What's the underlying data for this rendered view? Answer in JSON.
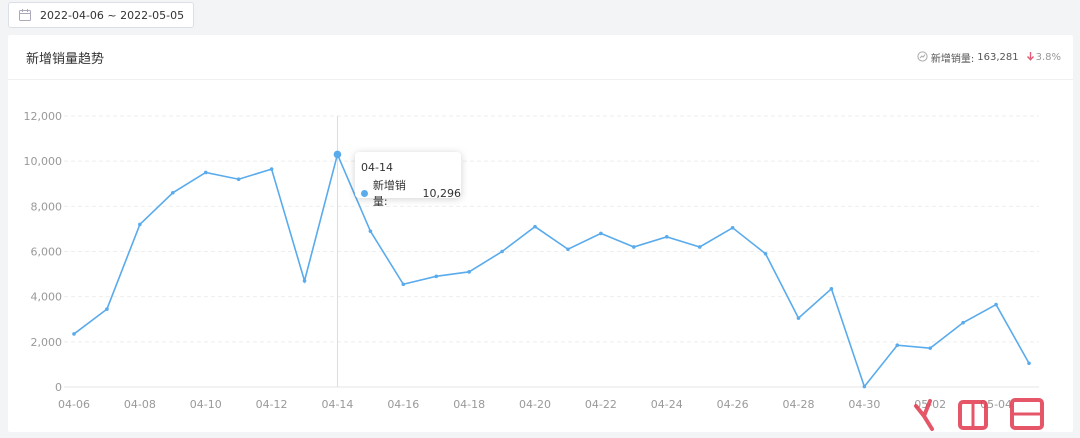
{
  "date_range": {
    "value": "2022-04-06 ~ 2022-05-05"
  },
  "card": {
    "title": "新增销量趋势",
    "summary_label": "新增销量:",
    "summary_value": "163,281",
    "delta_value": "3.8%"
  },
  "tooltip": {
    "date": "04-14",
    "series_label": "新增销量:",
    "value": "10,296"
  },
  "colors": {
    "line": "#5aabec",
    "delta_down": "#e55a75"
  },
  "icons": {
    "date_range": "calendar-icon",
    "summary": "trend-icon",
    "delta": "arrow-down-icon"
  },
  "chart_data": {
    "type": "line",
    "title": "",
    "xlabel": "",
    "ylabel": "",
    "ylim": [
      0,
      12000
    ],
    "yticks": [
      0,
      2000,
      4000,
      6000,
      8000,
      10000,
      12000
    ],
    "ytick_labels": [
      "0",
      "2,000",
      "4,000",
      "6,000",
      "8,000",
      "10,000",
      "12,000"
    ],
    "xtick_labels": [
      "04-06",
      "04-08",
      "04-10",
      "04-12",
      "04-14",
      "04-16",
      "04-18",
      "04-20",
      "04-22",
      "04-24",
      "04-26",
      "04-28",
      "04-30",
      "05-02",
      "05-04"
    ],
    "grid": true,
    "x": [
      "04-06",
      "04-07",
      "04-08",
      "04-09",
      "04-10",
      "04-11",
      "04-12",
      "04-13",
      "04-14",
      "04-15",
      "04-16",
      "04-17",
      "04-18",
      "04-19",
      "04-20",
      "04-21",
      "04-22",
      "04-23",
      "04-24",
      "04-25",
      "04-26",
      "04-27",
      "04-28",
      "04-29",
      "04-30",
      "05-01",
      "05-02",
      "05-03",
      "05-04",
      "05-05"
    ],
    "series": [
      {
        "values": [
          2350,
          3450,
          7200,
          8600,
          9500,
          9200,
          9650,
          4700,
          10296,
          6900,
          4550,
          4900,
          5100,
          6000,
          7100,
          6100,
          6800,
          6200,
          6650,
          6200,
          7050,
          5900,
          3050,
          4350,
          20,
          1850,
          1720,
          2850,
          3650,
          1050
        ]
      }
    ]
  }
}
